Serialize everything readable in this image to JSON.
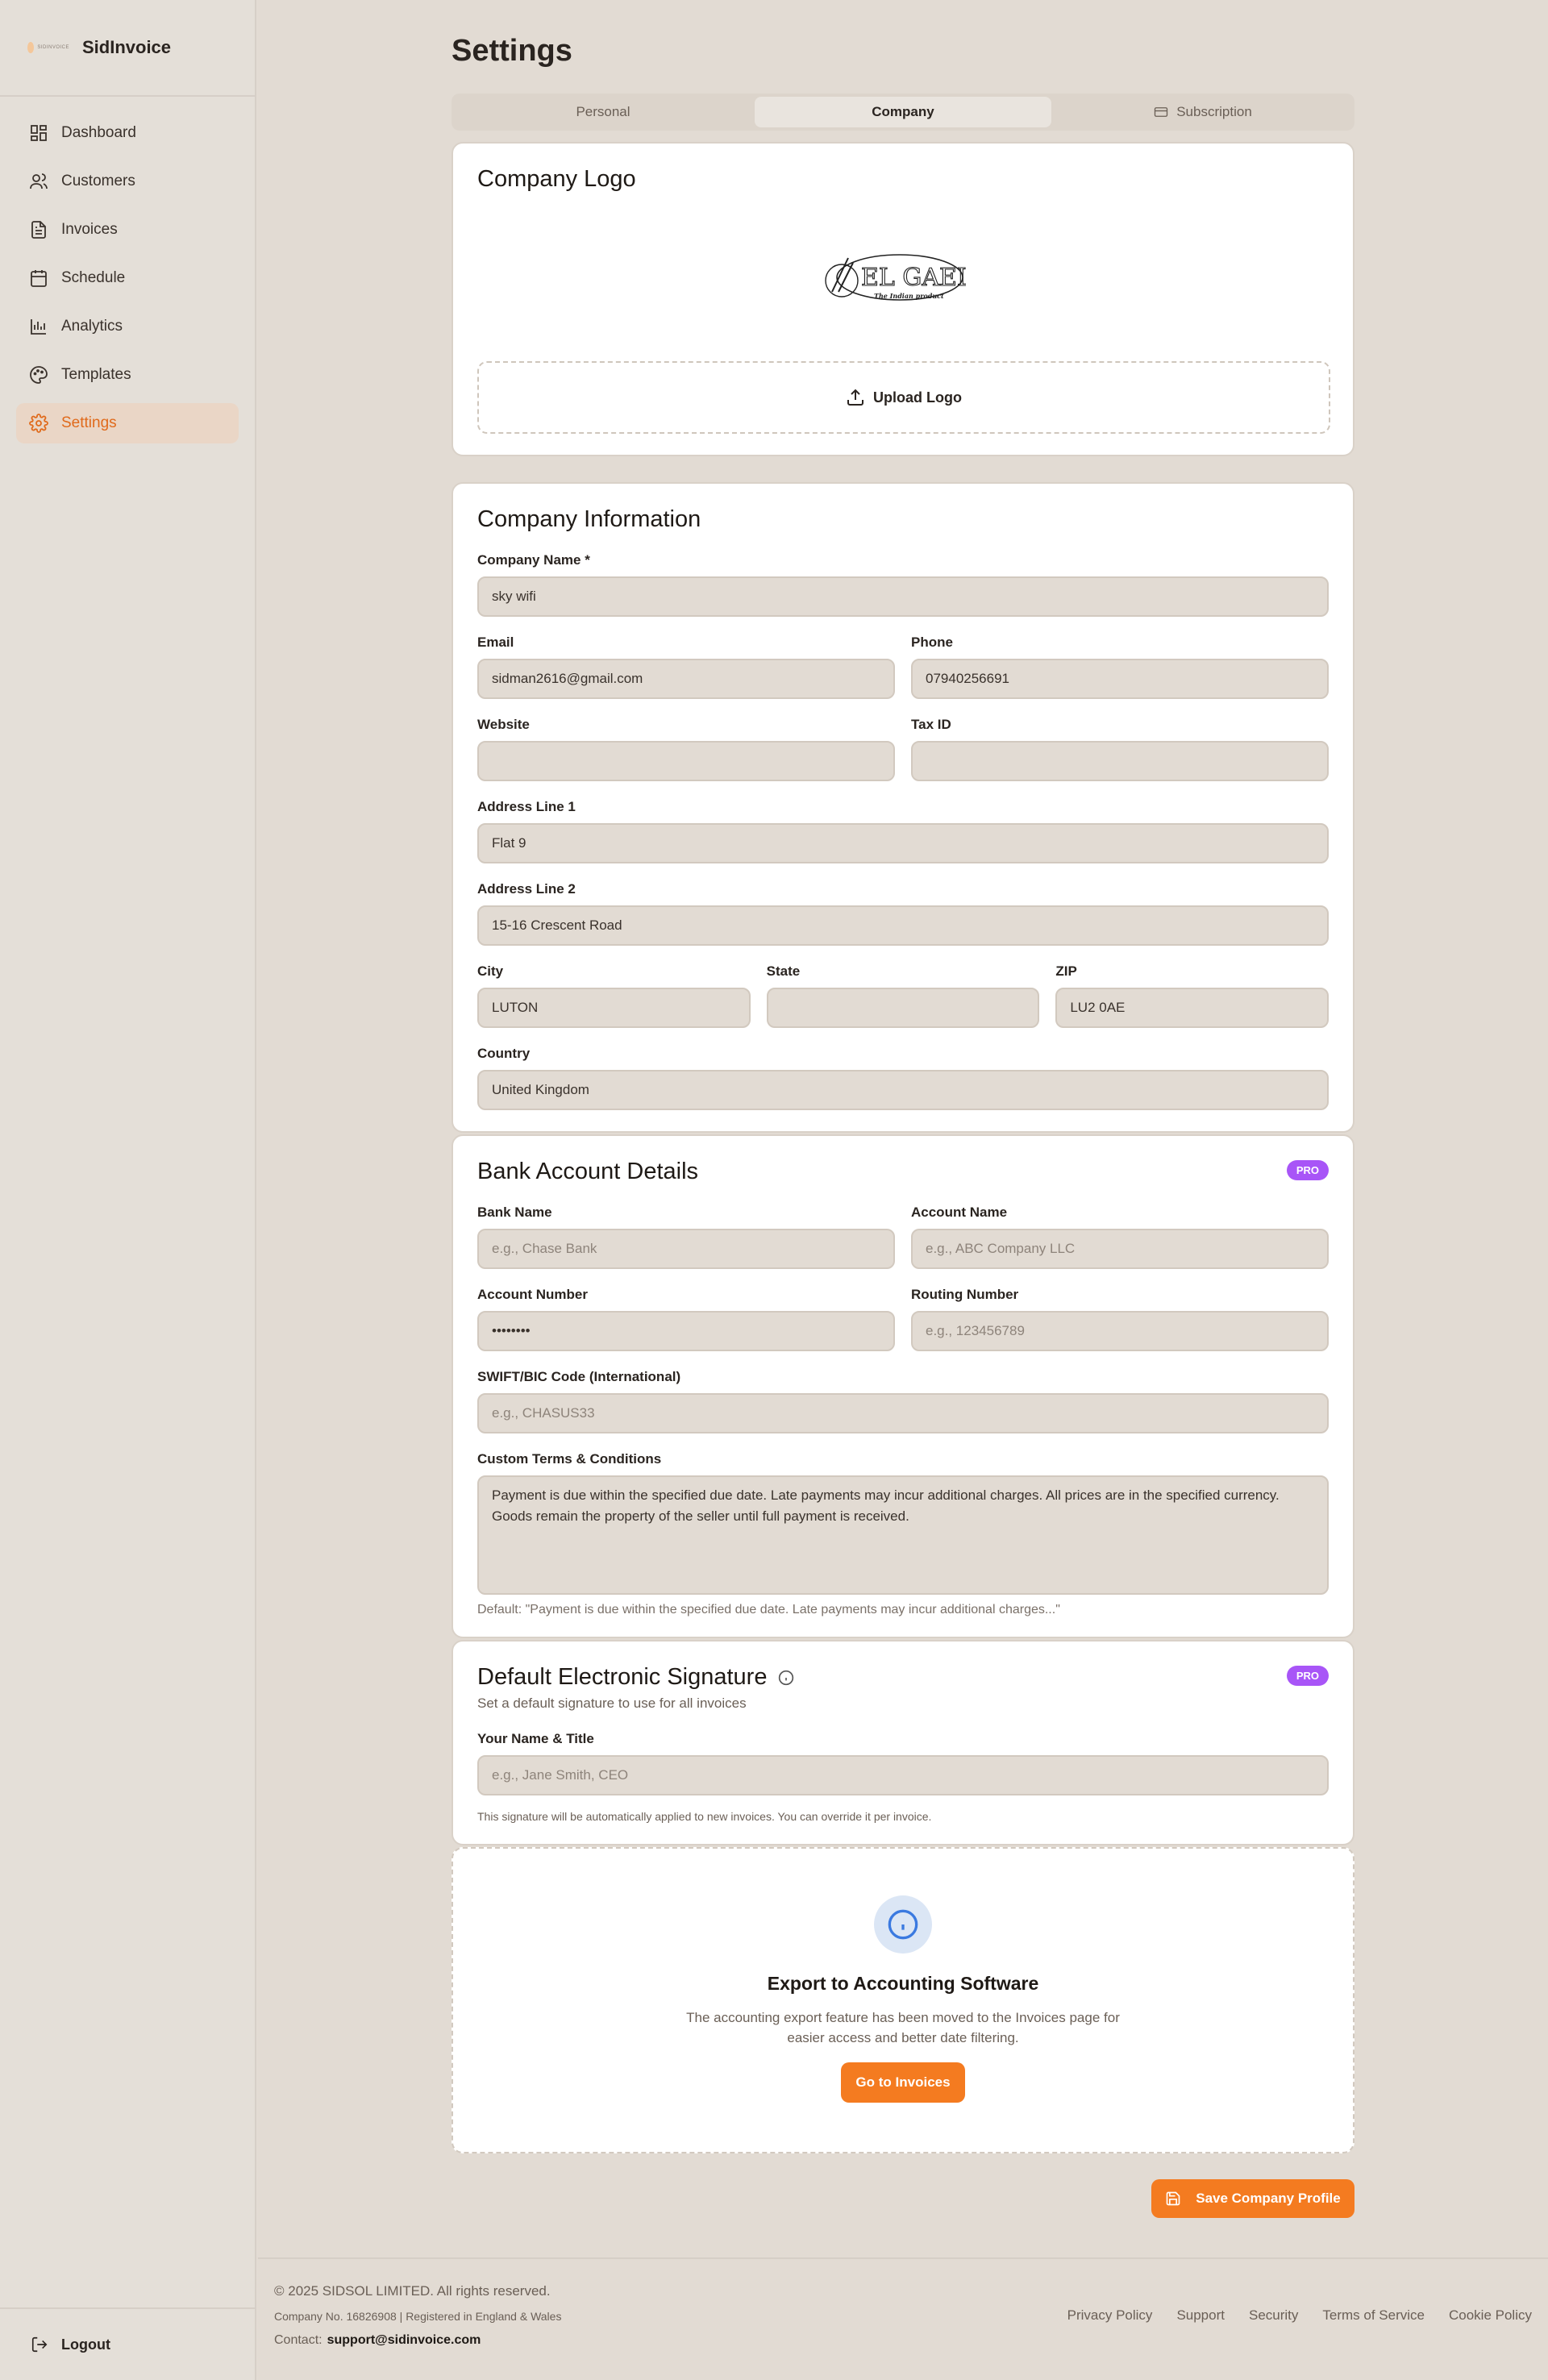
{
  "app": {
    "name": "SidInvoice",
    "logo_text": "SIDINVOICE"
  },
  "sidebar": {
    "items": [
      {
        "label": "Dashboard",
        "icon": "dashboard-icon"
      },
      {
        "label": "Customers",
        "icon": "users-icon"
      },
      {
        "label": "Invoices",
        "icon": "file-text-icon"
      },
      {
        "label": "Schedule",
        "icon": "calendar-icon"
      },
      {
        "label": "Analytics",
        "icon": "bar-chart-icon"
      },
      {
        "label": "Templates",
        "icon": "palette-icon"
      },
      {
        "label": "Settings",
        "icon": "gear-icon",
        "active": true
      }
    ],
    "logout": "Logout"
  },
  "page": {
    "title": "Settings"
  },
  "tabs": [
    {
      "label": "Personal"
    },
    {
      "label": "Company",
      "active": true
    },
    {
      "label": "Subscription"
    }
  ],
  "logo_section": {
    "title": "Company Logo",
    "logo_main": "EL GAEL",
    "logo_sub": "The Indian product",
    "upload_label": "Upload Logo"
  },
  "company_info": {
    "title": "Company Information",
    "company_name": {
      "label": "Company Name *",
      "value": "sky wifi"
    },
    "email": {
      "label": "Email",
      "value": "sidman2616@gmail.com"
    },
    "phone": {
      "label": "Phone",
      "value": "07940256691"
    },
    "website": {
      "label": "Website",
      "value": ""
    },
    "tax_id": {
      "label": "Tax ID",
      "value": ""
    },
    "address1": {
      "label": "Address Line 1",
      "value": "Flat 9"
    },
    "address2": {
      "label": "Address Line 2",
      "value": "15-16 Crescent Road"
    },
    "city": {
      "label": "City",
      "value": "LUTON"
    },
    "state": {
      "label": "State",
      "value": ""
    },
    "zip": {
      "label": "ZIP",
      "value": "LU2 0AE"
    },
    "country": {
      "label": "Country",
      "value": "United Kingdom"
    }
  },
  "bank": {
    "title": "Bank Account Details",
    "badge": "PRO",
    "bank_name": {
      "label": "Bank Name",
      "placeholder": "e.g., Chase Bank"
    },
    "account_name": {
      "label": "Account Name",
      "placeholder": "e.g., ABC Company LLC"
    },
    "account_number": {
      "label": "Account Number",
      "value": "••••••••"
    },
    "routing_number": {
      "label": "Routing Number",
      "placeholder": "e.g., 123456789"
    },
    "swift": {
      "label": "SWIFT/BIC Code (International)",
      "placeholder": "e.g., CHASUS33"
    },
    "terms": {
      "label": "Custom Terms & Conditions",
      "value": "Payment is due within the specified due date. Late payments may incur additional charges. All prices are in the specified currency. Goods remain the property of the seller until full payment is received.",
      "help": "Default: \"Payment is due within the specified due date. Late payments may incur additional charges...\""
    }
  },
  "signature": {
    "title": "Default Electronic Signature",
    "badge": "PRO",
    "subtitle": "Set a default signature to use for all invoices",
    "name_title": {
      "label": "Your Name & Title",
      "placeholder": "e.g., Jane Smith, CEO"
    },
    "help": "This signature will be automatically applied to new invoices. You can override it per invoice."
  },
  "export": {
    "title": "Export to Accounting Software",
    "description": "The accounting export feature has been moved to the Invoices page for easier access and better date filtering.",
    "button": "Go to Invoices"
  },
  "save_button": "Save Company Profile",
  "footer": {
    "copyright": "© 2025 SIDSOL LIMITED. All rights reserved.",
    "registration": "Company No. 16826908 | Registered in England & Wales",
    "contact_label": "Contact:",
    "contact_email": "support@sidinvoice.com",
    "links": [
      "Privacy Policy",
      "Support",
      "Security",
      "Terms of Service",
      "Cookie Policy"
    ]
  },
  "colors": {
    "accent": "#f47b20",
    "pro_badge": "#a855f7",
    "background": "#e2dbd3",
    "info_blue": "#3b7ae0"
  }
}
